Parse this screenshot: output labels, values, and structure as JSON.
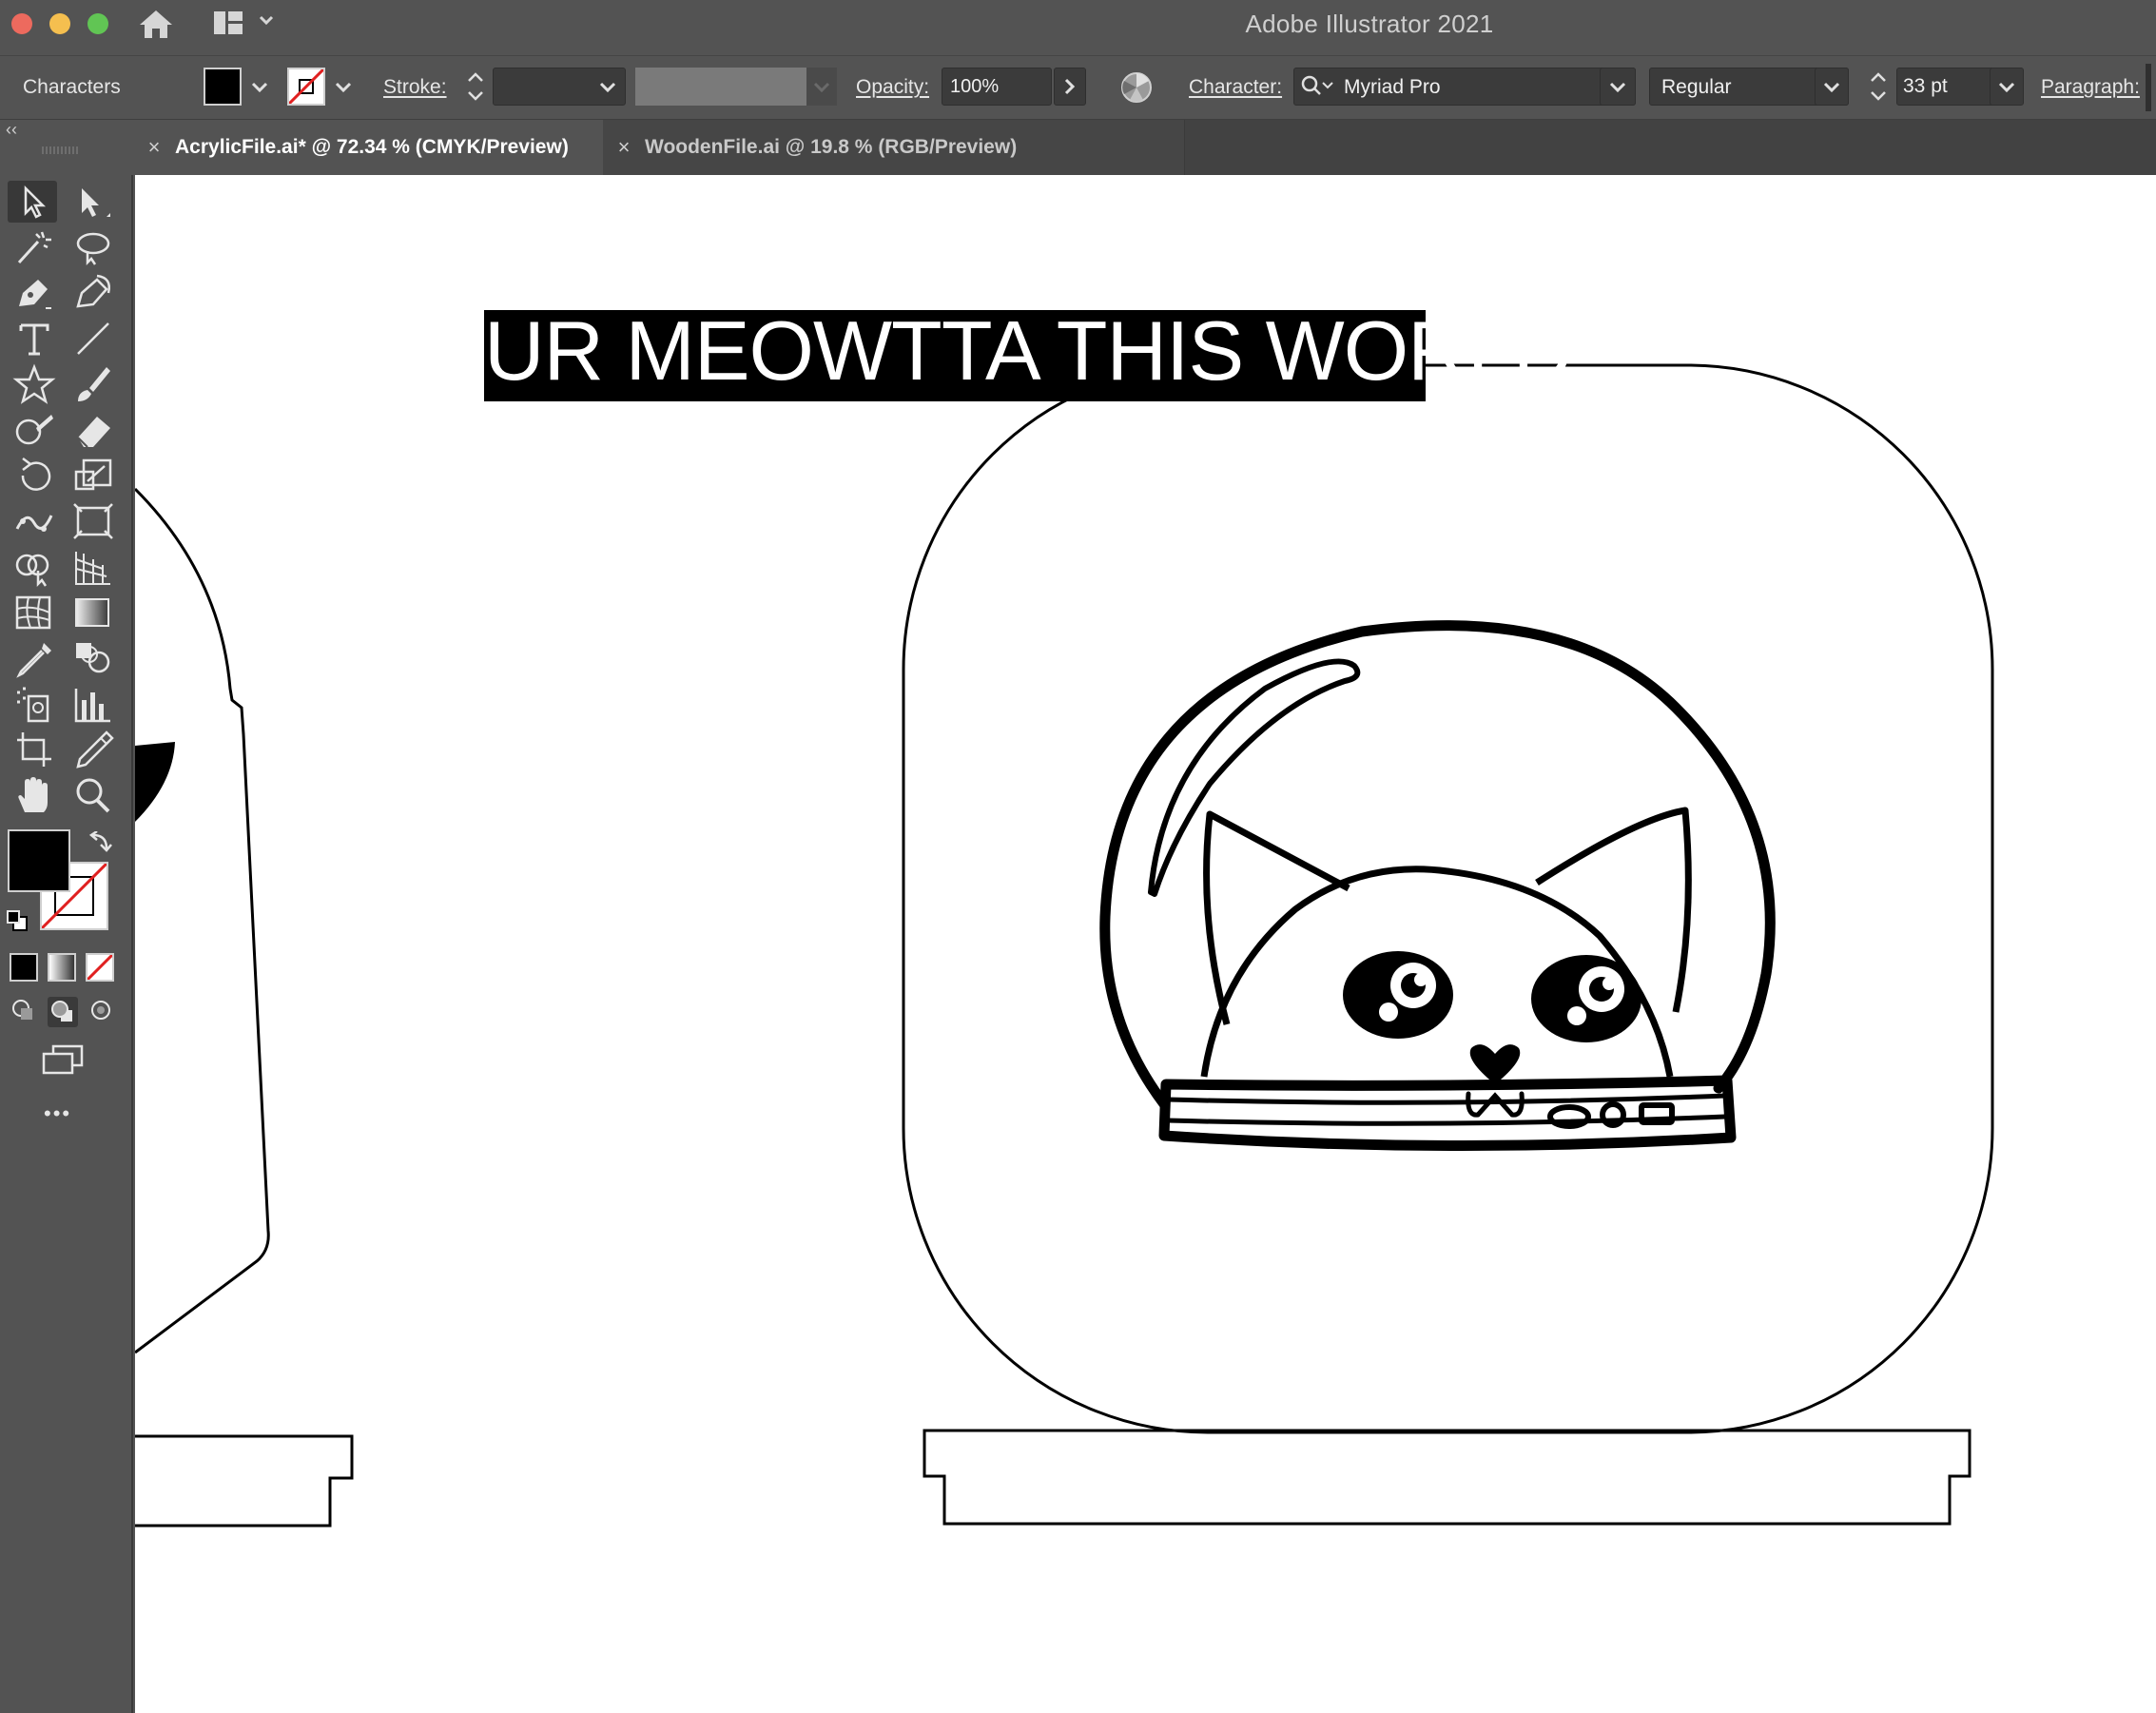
{
  "window": {
    "app_title": "Adobe Illustrator 2021"
  },
  "control_bar": {
    "panel_name": "Characters",
    "stroke_label": "Stroke:",
    "opacity_label": "Opacity:",
    "opacity_value": "100%",
    "character_label": "Character:",
    "font_family": "Myriad Pro",
    "font_style": "Regular",
    "font_size": "33 pt",
    "paragraph_label": "Paragraph:"
  },
  "tabs": [
    {
      "label": "AcrylicFile.ai* @ 72.34 % (CMYK/Preview)",
      "active": true
    },
    {
      "label": "WoodenFile.ai @ 19.8 % (RGB/Preview)",
      "active": false
    }
  ],
  "toolbar": {
    "collapse_glyph": "‹‹",
    "more_glyph": "•••",
    "fill_color": "#000000",
    "stroke_color": "none"
  },
  "canvas": {
    "headline_text": "UR MEOWTTA THIS WORLD"
  },
  "colors": {
    "ui_background": "#535353",
    "tab_bar": "#424242",
    "canvas": "#ffffff",
    "traffic_close": "#ed6a5e",
    "traffic_min": "#f5bf4f",
    "traffic_max": "#61c554"
  }
}
